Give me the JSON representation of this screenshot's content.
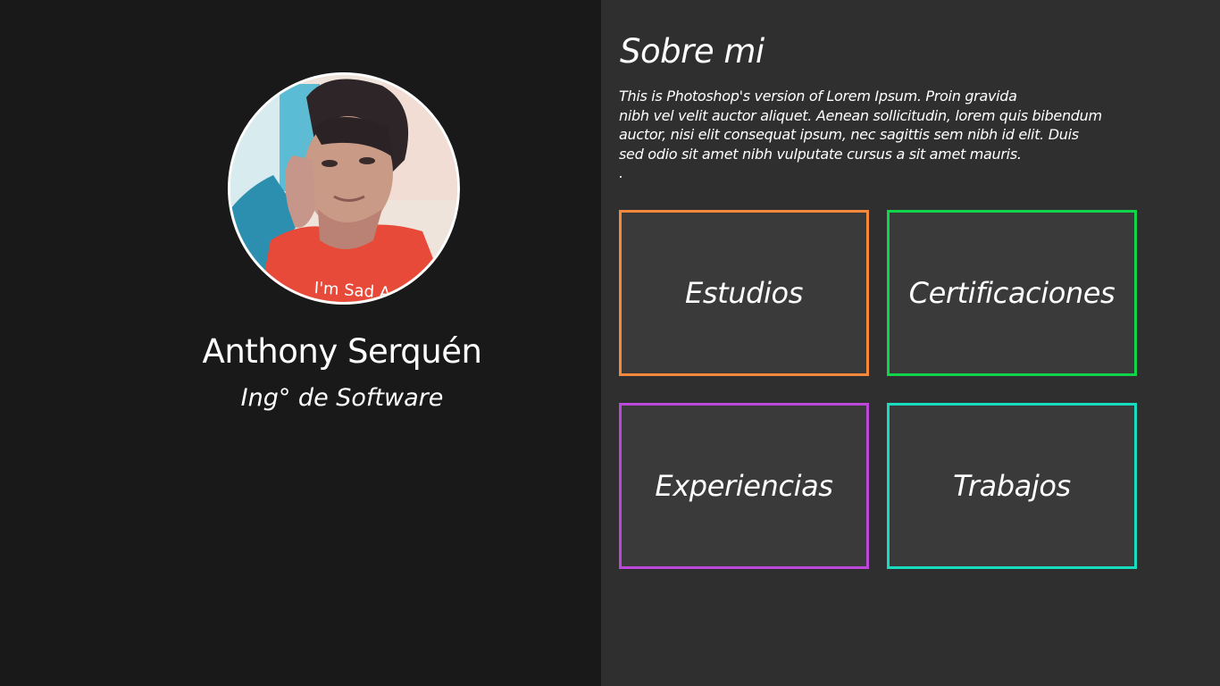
{
  "profile": {
    "name": "Anthony Serquén",
    "role": "Ing° de Software",
    "photo_shirt_text": "I'm Sad A"
  },
  "about": {
    "title": "Sobre mi",
    "text": "This is Photoshop's version  of Lorem Ipsum. Proin gravida\nnibh vel velit auctor aliquet. Aenean sollicitudin, lorem quis bibendum\nauctor, nisi elit consequat ipsum, nec sagittis sem nibh id elit. Duis\nsed odio sit amet nibh vulputate cursus a sit amet mauris.\n."
  },
  "cards": [
    {
      "label": "Estudios",
      "color": "#f5893b"
    },
    {
      "label": "Certificaciones",
      "color": "#11d44a"
    },
    {
      "label": "Experiencias",
      "color": "#bb47db"
    },
    {
      "label": "Trabajos",
      "color": "#18dcc0"
    }
  ],
  "colors": {
    "left_background": "#191919",
    "right_background": "#2f2f2f",
    "card_background": "#3a3a3a",
    "text": "#ffffff"
  }
}
